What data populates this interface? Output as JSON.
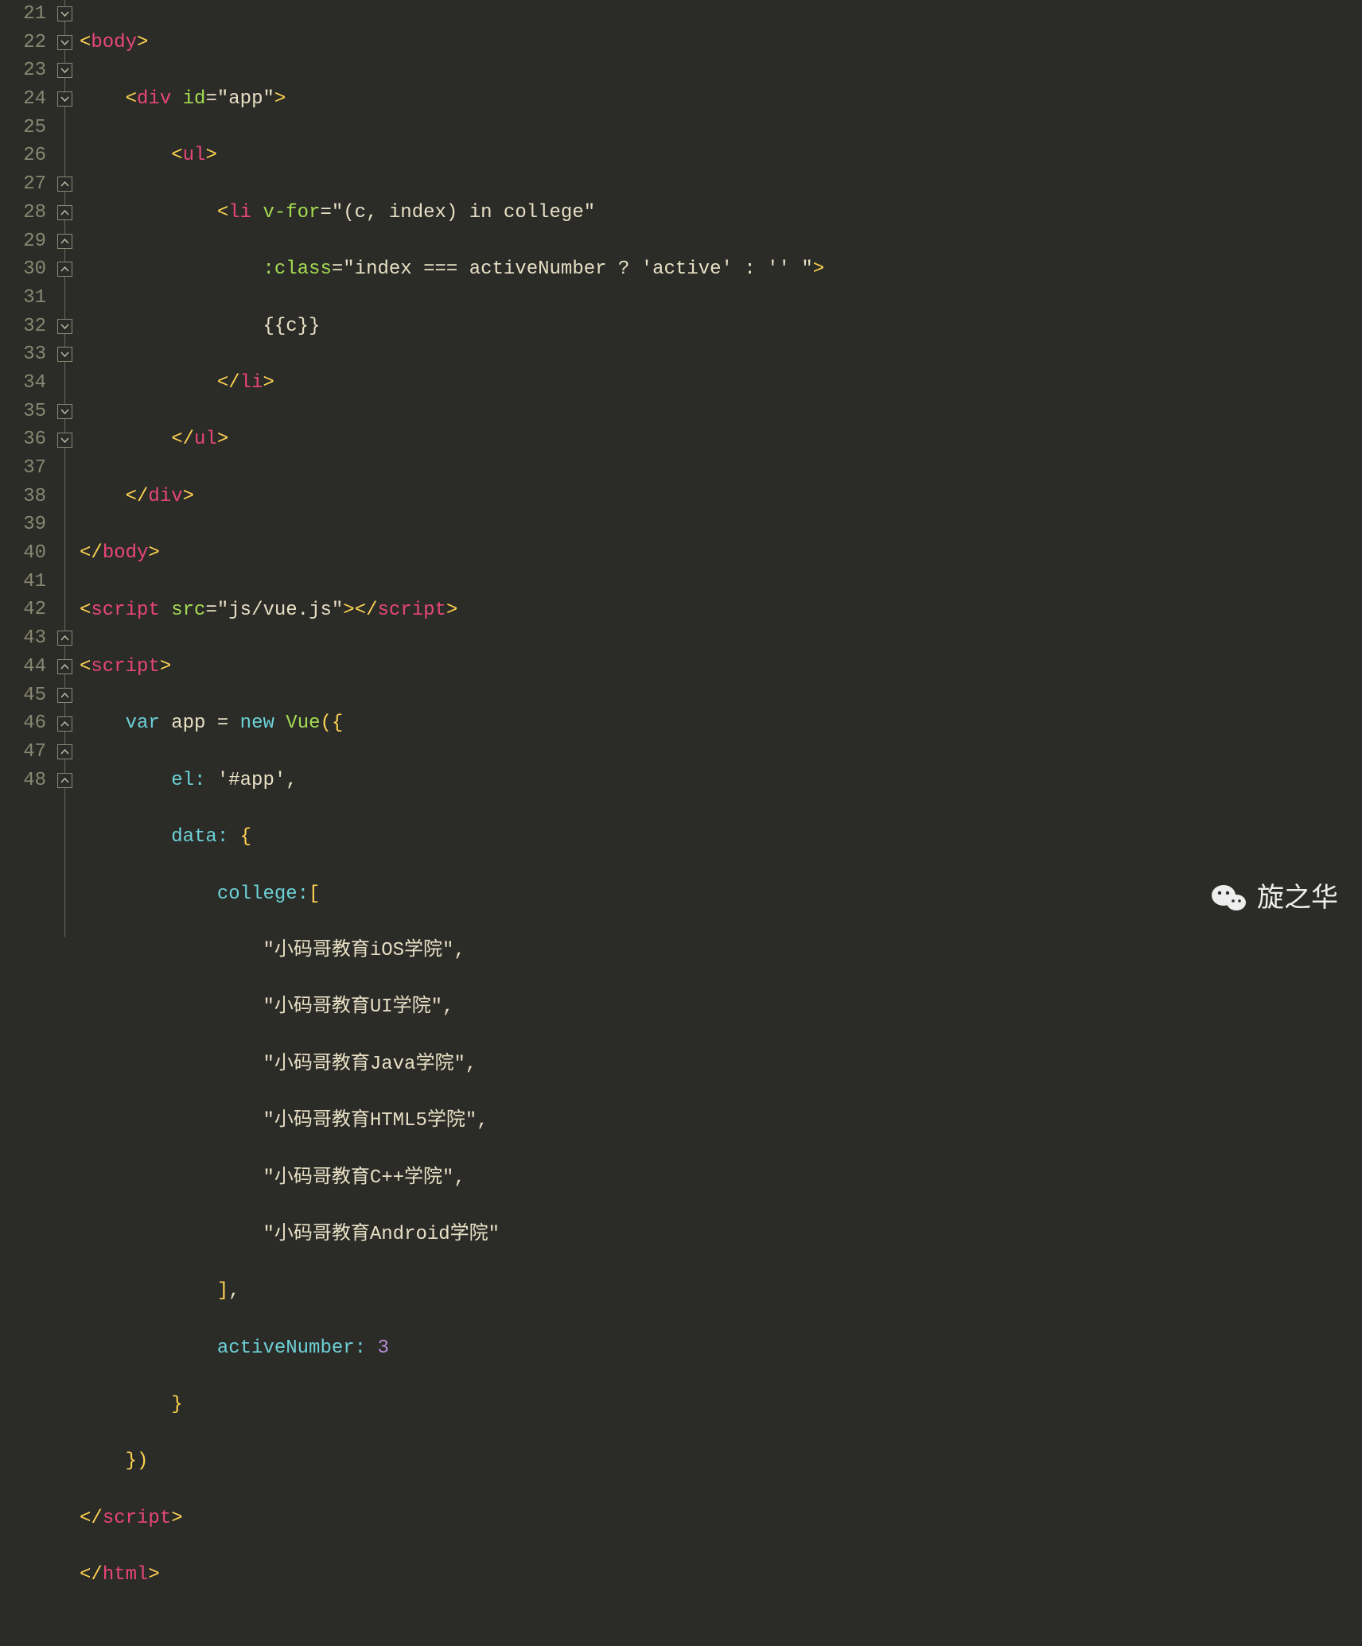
{
  "line_numbers": [
    "21",
    "22",
    "23",
    "24",
    "25",
    "26",
    "27",
    "28",
    "29",
    "30",
    "31",
    "32",
    "33",
    "34",
    "35",
    "36",
    "37",
    "38",
    "39",
    "40",
    "41",
    "42",
    "43",
    "44",
    "45",
    "46",
    "47",
    "48"
  ],
  "fold_markers": {
    "down": [
      0,
      1,
      2,
      3,
      11,
      12,
      14,
      15
    ],
    "up": [
      6,
      7,
      8,
      9,
      22,
      23,
      24,
      25,
      26,
      27
    ]
  },
  "code": {
    "l21_tag": "body",
    "l22_tag": "div",
    "l22_attr": "id",
    "l22_val": "\"app\"",
    "l23_tag": "ul",
    "l24_tag": "li",
    "l24_attr": "v-for",
    "l24_val": "\"(c, index) in college\"",
    "l25_attr": ":class",
    "l25_val": "\"index === activeNumber ? 'active' : '' \"",
    "l26_txt": "{{c}}",
    "l27_tag": "li",
    "l28_tag": "ul",
    "l29_tag": "div",
    "l30_tag": "body",
    "l31_tag": "script",
    "l31_attr": "src",
    "l31_val": "\"js/vue.js\"",
    "l31_close": "script",
    "l32_tag": "script",
    "l33_var": "var",
    "l33_app": "app",
    "l33_eq": " = ",
    "l33_new": "new",
    "l33_vue": "Vue",
    "l33_paren": "({",
    "l34_key": "el:",
    "l34_val": "'#app'",
    "l35_key": "data:",
    "l35_brace": "{",
    "l36_key": "college:",
    "l36_brk": "[",
    "l37": "\"小码哥教育iOS学院\"",
    "l38": "\"小码哥教育UI学院\"",
    "l39": "\"小码哥教育Java学院\"",
    "l40": "\"小码哥教育HTML5学院\"",
    "l41": "\"小码哥教育C++学院\"",
    "l42": "\"小码哥教育Android学院\"",
    "l43_brk": "]",
    "l44_key": "activeNumber:",
    "l44_val": "3",
    "l45_brace": "}",
    "l46_close": "})",
    "l47_tag": "script",
    "l48_tag": "html"
  },
  "watermark": {
    "text": "旋之华"
  }
}
